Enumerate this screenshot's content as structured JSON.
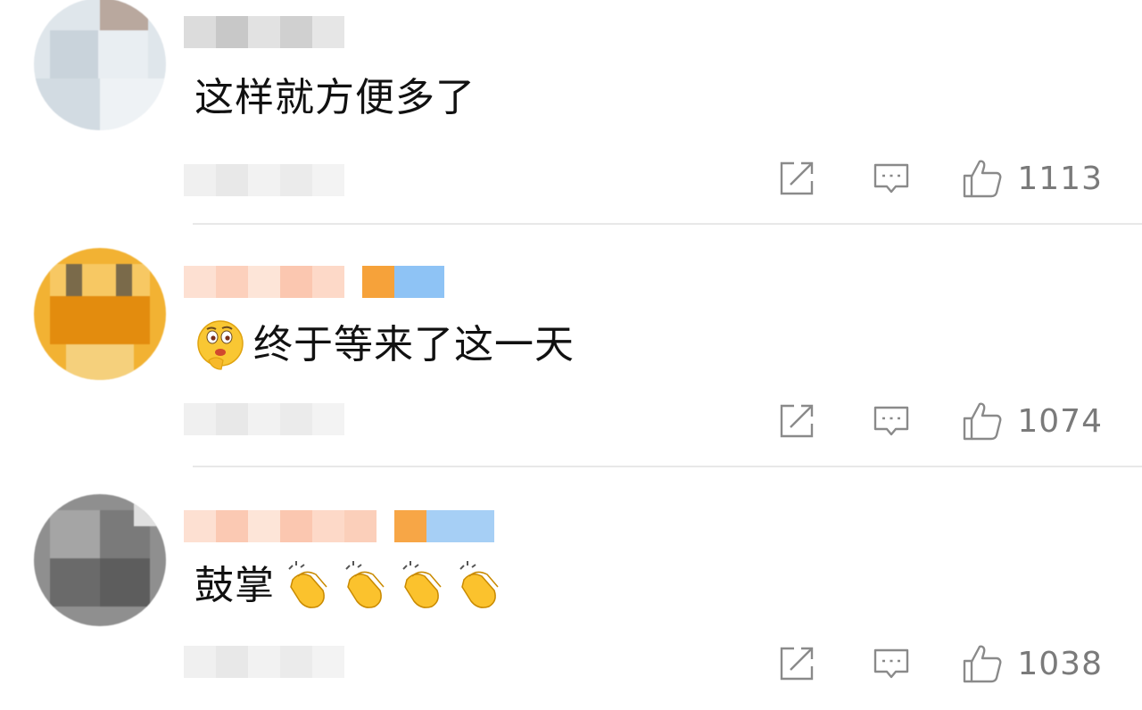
{
  "comments": [
    {
      "text": "这样就方便多了",
      "emoji_prefix": "",
      "emoji_suffix": "",
      "likes": "1113",
      "avatar_colors": [
        "#d6dde3",
        "#c7ced6",
        "#e6ecf0",
        "#b9a89e",
        "#dfe5ea",
        "#cfd7de"
      ]
    },
    {
      "text": "终于等来了这一天",
      "emoji_prefix": "thinking-face",
      "emoji_suffix": "",
      "likes": "1074",
      "avatar_colors": [
        "#f3b23a",
        "#e99a14",
        "#f6c45a",
        "#d8860b",
        "#f5d27e",
        "#c9790a"
      ]
    },
    {
      "text": "鼓掌",
      "emoji_prefix": "",
      "emoji_suffix": "clapping-hands x4",
      "likes": "1038",
      "avatar_colors": [
        "#8a8a8a",
        "#6f6f6f",
        "#a3a3a3",
        "#5e5e5e",
        "#bdbdbd",
        "#7c7c7c"
      ]
    }
  ],
  "icons": {
    "share": "share-icon",
    "reply": "comment-icon",
    "like": "thumbs-up-icon"
  },
  "colors": {
    "like_text": "#7a7a7a",
    "icon_stroke": "#8a8a8a",
    "divider": "#e8e8e8"
  }
}
